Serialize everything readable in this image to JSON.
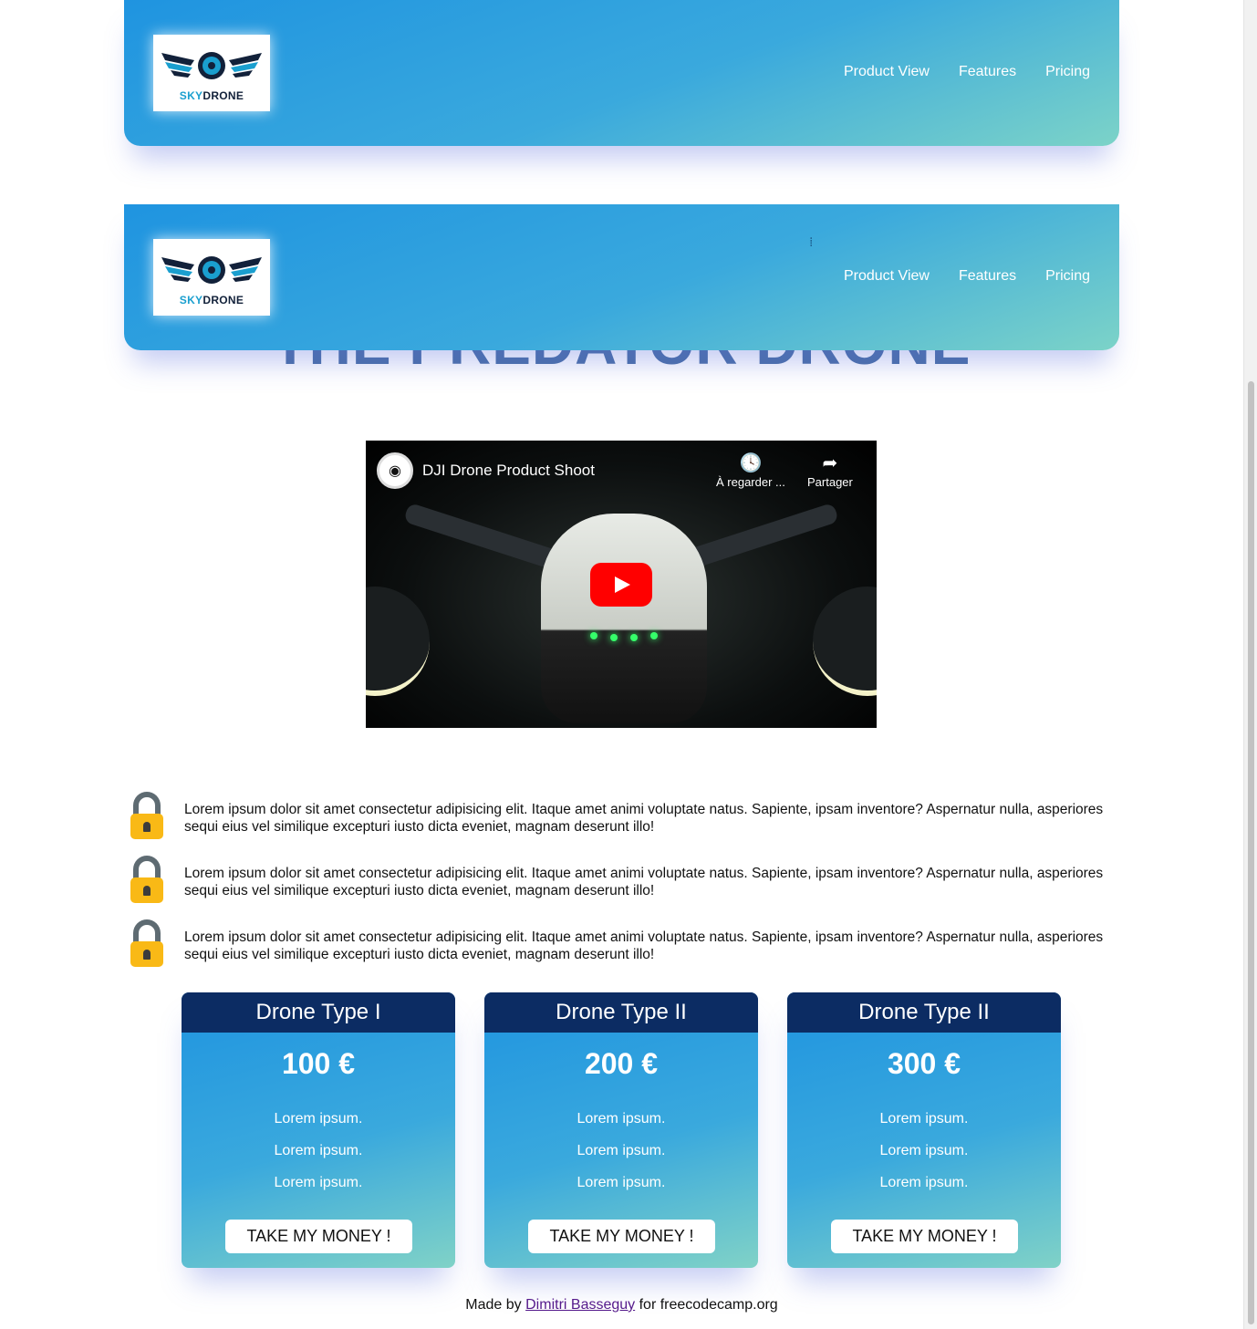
{
  "header": {
    "logo": {
      "sky": "SKY",
      "drone": "DRONE"
    },
    "nav": [
      "Product View",
      "Features",
      "Pricing"
    ]
  },
  "title": "THE PREDATOR DRONE",
  "video": {
    "title": "DJI Drone Product Shoot",
    "watch_later": "À regarder ...",
    "share": "Partager"
  },
  "features": [
    "Lorem ipsum dolor sit amet consectetur adipisicing elit. Itaque amet animi voluptate natus. Sapiente, ipsam inventore? Aspernatur nulla, asperiores sequi eius vel similique excepturi iusto dicta eveniet, magnam deserunt illo!",
    "Lorem ipsum dolor sit amet consectetur adipisicing elit. Itaque amet animi voluptate natus. Sapiente, ipsam inventore? Aspernatur nulla, asperiores sequi eius vel similique excepturi iusto dicta eveniet, magnam deserunt illo!",
    "Lorem ipsum dolor sit amet consectetur adipisicing elit. Itaque amet animi voluptate natus. Sapiente, ipsam inventore? Aspernatur nulla, asperiores sequi eius vel similique excepturi iusto dicta eveniet, magnam deserunt illo!"
  ],
  "pricing": [
    {
      "name": "Drone Type I",
      "price": "100 €",
      "items": [
        "Lorem ipsum.",
        "Lorem ipsum.",
        "Lorem ipsum."
      ],
      "button": "TAKE MY MONEY !"
    },
    {
      "name": "Drone Type II",
      "price": "200 €",
      "items": [
        "Lorem ipsum.",
        "Lorem ipsum.",
        "Lorem ipsum."
      ],
      "button": "TAKE MY MONEY !"
    },
    {
      "name": "Drone Type II",
      "price": "300 €",
      "items": [
        "Lorem ipsum.",
        "Lorem ipsum.",
        "Lorem ipsum."
      ],
      "button": "TAKE MY MONEY !"
    }
  ],
  "footer": {
    "prefix": "Made by",
    "author": "Dimitri Basseguy",
    "suffix": "for freecodecamp.org"
  },
  "colors": {
    "header_start": "#1f94e0",
    "header_end": "#7cd3c8",
    "card_head": "#0c2c63",
    "lock": "#f9b916"
  },
  "icons": {
    "lock": "lock-icon",
    "play": "play-icon",
    "clock": "clock-icon",
    "share": "share-icon"
  }
}
